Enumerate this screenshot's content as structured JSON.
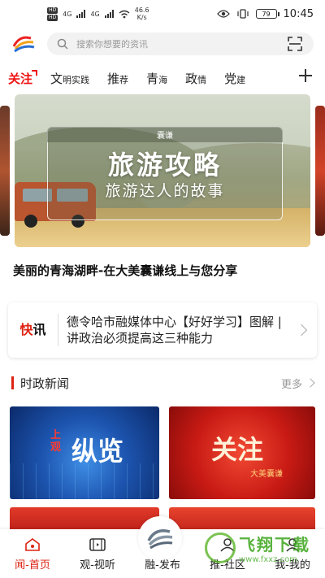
{
  "status_bar": {
    "hd1": "HD",
    "hd2": "HD",
    "net1": "4G",
    "net2": "4G",
    "speed": "46.6",
    "speed_unit": "K/s",
    "battery": "79",
    "time": "10:45"
  },
  "header": {
    "search_placeholder": "搜索你想要的资讯"
  },
  "tabs": [
    {
      "label": "关注",
      "small": ""
    },
    {
      "label": "文",
      "small": "明实践"
    },
    {
      "label": "推",
      "small": "荐"
    },
    {
      "label": "青",
      "small": "海"
    },
    {
      "label": "政",
      "small": "情"
    },
    {
      "label": "党",
      "small": "建"
    }
  ],
  "banner": {
    "tag": "囊谦",
    "title": "旅游攻略",
    "subtitle": "旅游达人的故事",
    "caption": "美丽的青海湖畔-在大美囊谦线上与您分享"
  },
  "flash": {
    "label_red": "快",
    "label_black": "讯",
    "text": "德令哈市融媒体中心【好好学习】图解 | 讲政治必须提高这三种能力"
  },
  "section": {
    "title": "时政新闻",
    "more": "更多"
  },
  "thumbs": [
    {
      "title": "纵览",
      "prefix": "上观"
    },
    {
      "title": "关注",
      "subtitle": "大美囊谦"
    }
  ],
  "bottom_nav": [
    {
      "label": "闻-首页"
    },
    {
      "label": "观-视听"
    },
    {
      "label": "融-发布"
    },
    {
      "label": "推-社区"
    },
    {
      "label": "我-我的"
    }
  ],
  "watermark": {
    "main": "飞翔下载",
    "sub": "www.fxxz.com"
  },
  "colors": {
    "accent": "#dd1111",
    "watermark_green": "#46aa28"
  }
}
